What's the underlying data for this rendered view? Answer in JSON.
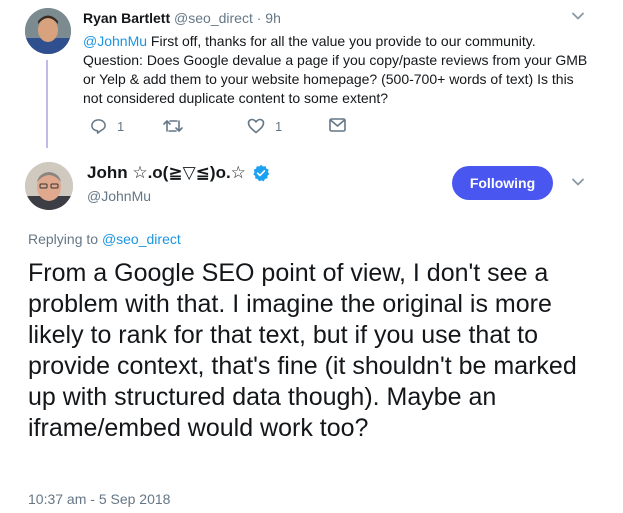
{
  "reply_tweet": {
    "author_name": "Ryan Bartlett",
    "author_handle": "@seo_direct",
    "separator": "·",
    "age": "9h",
    "mention": "@JohnMu",
    "text": " First off, thanks for all the value you provide to our community. Question: Does Google devalue a page if you copy/paste reviews from your GMB or Yelp & add them to your website homepage? (500-700+ words of text) Is this not considered duplicate content to some extent?",
    "reply_count": "1",
    "like_count": "1",
    "icons": [
      "reply-icon",
      "retweet-icon",
      "like-icon",
      "message-icon",
      "chevron-down-icon"
    ]
  },
  "main_tweet": {
    "author_name": "John ☆.o(≧▽≦)o.☆",
    "author_handle": "@JohnMu",
    "verified": true,
    "follow_label": "Following",
    "replying_prefix": "Replying to ",
    "replying_to": "@seo_direct",
    "text": "From a Google SEO point of view, I don't see a problem with that. I imagine the original is more likely to rank for that text, but if you use that to provide context, that's fine (it shouldn't be marked up with structured data though). Maybe an iframe/embed would work too?",
    "timestamp": "10:37 am - 5 Sep 2018"
  },
  "colors": {
    "link": "#1b95e0",
    "button": "#4a56f0",
    "thread_line": "#c4b8e8",
    "muted": "#657786"
  }
}
